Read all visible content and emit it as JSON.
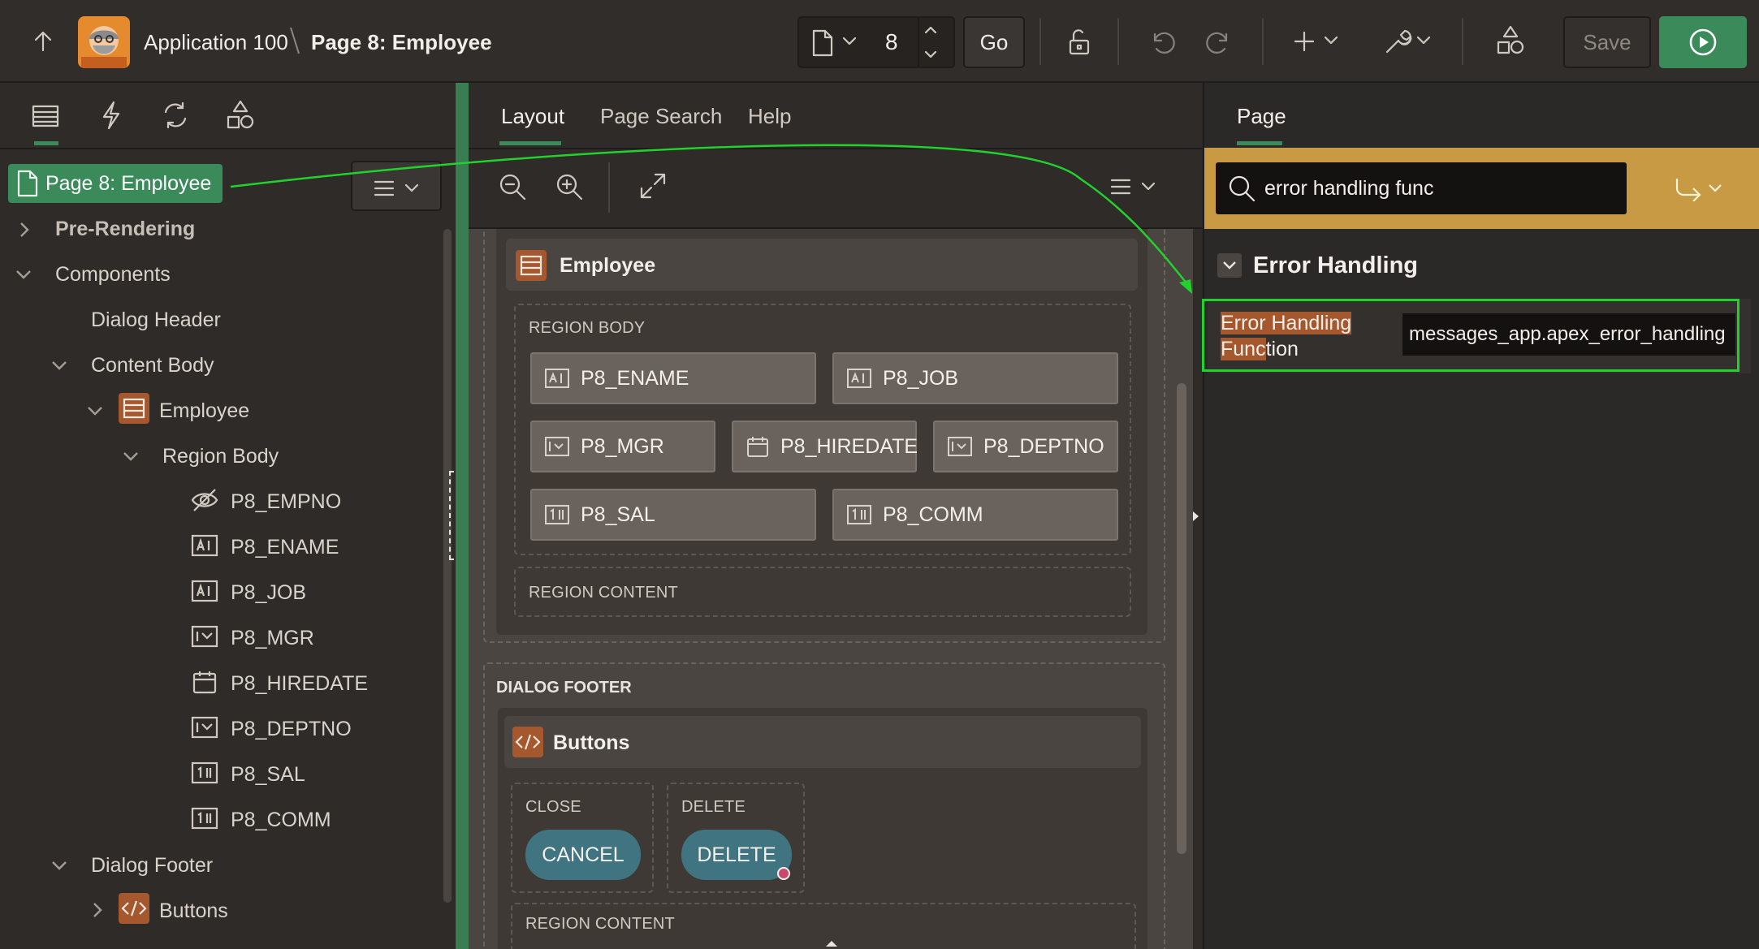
{
  "topbar": {
    "app_title": "Application 100",
    "page_title": "Page 8: Employee",
    "page_number": "8",
    "go_label": "Go",
    "save_label": "Save"
  },
  "left": {
    "tabs": [
      "rendering",
      "dynamic-actions",
      "processing",
      "shared-components"
    ],
    "root_label": "Page 8: Employee",
    "tree": {
      "pre_rendering": "Pre-Rendering",
      "components": "Components",
      "dialog_header": "Dialog Header",
      "content_body": "Content Body",
      "employee": "Employee",
      "region_body": "Region Body",
      "items": [
        "P8_EMPNO",
        "P8_ENAME",
        "P8_JOB",
        "P8_MGR",
        "P8_HIREDATE",
        "P8_DEPTNO",
        "P8_SAL",
        "P8_COMM"
      ],
      "dialog_footer": "Dialog Footer",
      "buttons": "Buttons"
    }
  },
  "center": {
    "tabs": [
      "Layout",
      "Page Search",
      "Help"
    ],
    "region_title": "Employee",
    "region_body_label": "REGION BODY",
    "items": {
      "ename": "P8_ENAME",
      "job": "P8_JOB",
      "mgr": "P8_MGR",
      "hiredate": "P8_HIREDATE",
      "deptno": "P8_DEPTNO",
      "sal": "P8_SAL",
      "comm": "P8_COMM"
    },
    "region_content_label": "REGION CONTENT",
    "dialog_footer_label": "DIALOG FOOTER",
    "buttons_title": "Buttons",
    "close_label": "CLOSE",
    "delete_slot_label": "DELETE",
    "cancel_button": "CANCEL",
    "delete_button": "DELETE",
    "region_content_label_2": "REGION CONTENT"
  },
  "right": {
    "tab": "Page",
    "search_value": "error handling func",
    "section_title": "Error Handling",
    "property_label_highlight_1": "Error Handling",
    "property_label_highlight_2": "Func",
    "property_label_rest": "tion",
    "property_value": "messages_app.apex_error_handling"
  },
  "colors": {
    "accent_green": "#3a7d52",
    "run_green": "#3a8a5a",
    "annotation_green": "#22d22c",
    "search_bar_yellow": "#c79a43",
    "highlight_orange": "#a5582e"
  }
}
